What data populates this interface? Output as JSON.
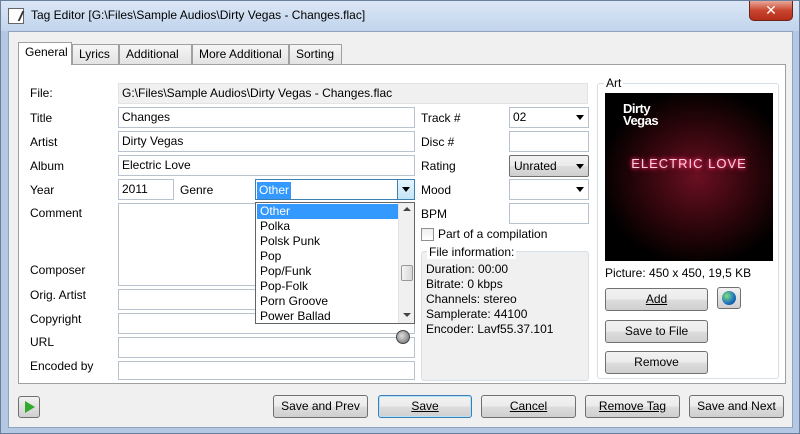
{
  "window": {
    "title": "Tag Editor [G:\\Files\\Sample Audios\\Dirty Vegas - Changes.flac]",
    "close_label": "✕"
  },
  "tabs": [
    {
      "label": "General"
    },
    {
      "label": "Lyrics"
    },
    {
      "label": "Additional"
    },
    {
      "label": "More Additional"
    },
    {
      "label": "Sorting"
    }
  ],
  "fields": {
    "file_label": "File:",
    "file_value": "G:\\Files\\Sample Audios\\Dirty Vegas - Changes.flac",
    "title_label": "Title",
    "title_value": "Changes",
    "artist_label": "Artist",
    "artist_value": "Dirty Vegas",
    "album_label": "Album",
    "album_value": "Electric Love",
    "year_label": "Year",
    "year_value": "2011",
    "genre_label": "Genre",
    "genre_value": "Other",
    "comment_label": "Comment",
    "composer_label": "Composer",
    "orig_artist_label": "Orig. Artist",
    "copyright_label": "Copyright",
    "url_label": "URL",
    "encoded_by_label": "Encoded by",
    "track_label": "Track #",
    "track_value": "02",
    "disc_label": "Disc #",
    "rating_label": "Rating",
    "rating_value": "Unrated",
    "mood_label": "Mood",
    "bpm_label": "BPM",
    "compilation_label": "Part of a compilation"
  },
  "genre_dropdown": {
    "items": [
      "Other",
      "Polka",
      "Polsk Punk",
      "Pop",
      "Pop/Funk",
      "Pop-Folk",
      "Porn Groove",
      "Power Ballad"
    ],
    "selected": "Other"
  },
  "file_info": {
    "title": "File information:",
    "duration": "Duration: 00:00",
    "bitrate": "Bitrate: 0 kbps",
    "channels": "Channels: stereo",
    "samplerate": "Samplerate: 44100",
    "encoder": "Encoder: Lavf55.37.101"
  },
  "art": {
    "title": "Art",
    "cover_band": "Dirty Vegas",
    "cover_band_line1": "Dirty",
    "cover_band_line2": "Vegas",
    "cover_title": "ELECTRIC LOVE",
    "picture_info": "Picture: 450 x 450, 19,5 KB",
    "add_label": "Add",
    "save_to_file_label": "Save to File",
    "remove_label": "Remove"
  },
  "buttons": {
    "save_prev": "Save and Prev",
    "save": "Save",
    "cancel": "Cancel",
    "remove_tag": "Remove Tag",
    "save_next": "Save and Next"
  },
  "colors": {
    "selection": "#3399ff",
    "cover_bg": "#000000",
    "cover_neon": "#e0245e"
  }
}
